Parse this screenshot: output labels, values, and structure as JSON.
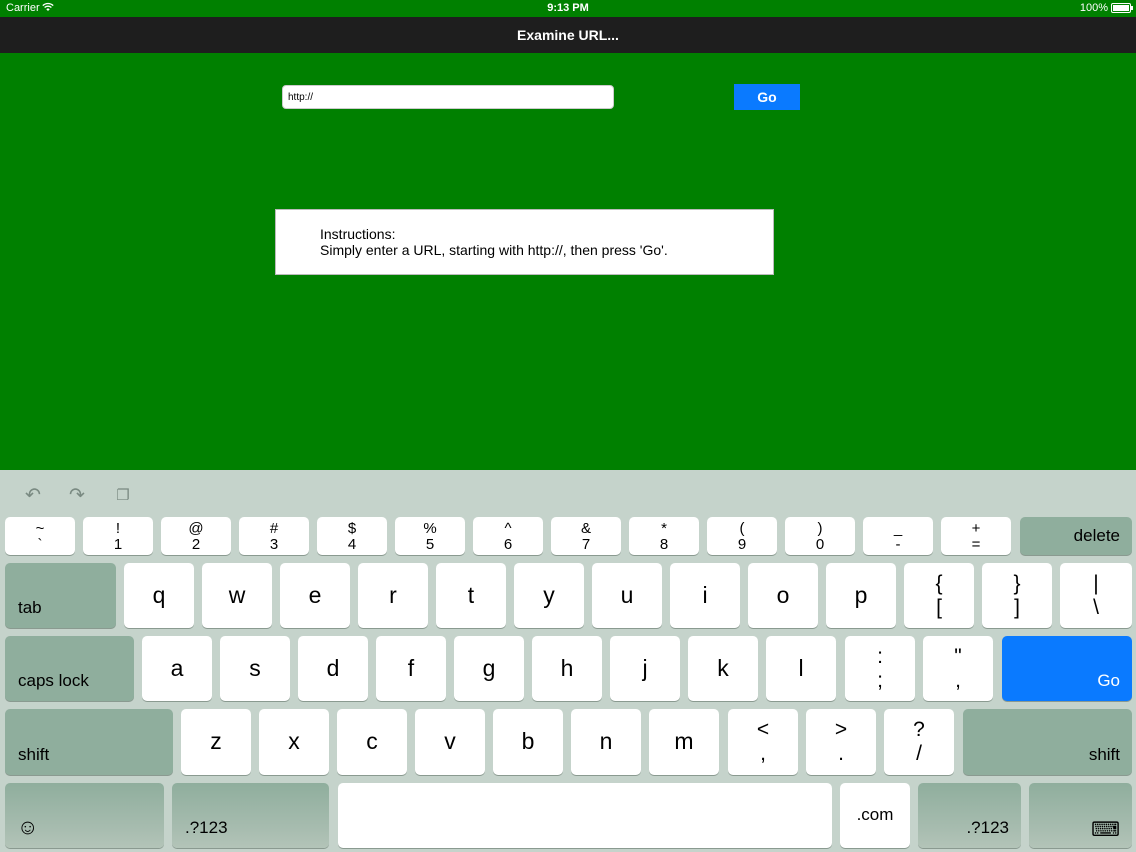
{
  "status_bar": {
    "carrier": "Carrier",
    "time": "9:13 PM",
    "battery": "100%"
  },
  "nav": {
    "title": "Examine URL..."
  },
  "url_field": {
    "value": "http://",
    "placeholder": ""
  },
  "go_button": {
    "label": "Go"
  },
  "instructions": {
    "heading": "Instructions:",
    "text": "Simply enter a URL, starting with http://, then press 'Go'."
  },
  "keyboard": {
    "shortcuts": {
      "undo": "↶",
      "redo": "↷",
      "paste": "❐"
    },
    "number_row": [
      {
        "top": "~",
        "bottom": "`"
      },
      {
        "top": "!",
        "bottom": "1"
      },
      {
        "top": "@",
        "bottom": "2"
      },
      {
        "top": "#",
        "bottom": "3"
      },
      {
        "top": "$",
        "bottom": "4"
      },
      {
        "top": "%",
        "bottom": "5"
      },
      {
        "top": "^",
        "bottom": "6"
      },
      {
        "top": "&",
        "bottom": "7"
      },
      {
        "top": "*",
        "bottom": "8"
      },
      {
        "top": "(",
        "bottom": "9"
      },
      {
        "top": ")",
        "bottom": "0"
      },
      {
        "top": "_",
        "bottom": "-"
      },
      {
        "top": "+",
        "bottom": "="
      }
    ],
    "delete": "delete",
    "tab": "tab",
    "row_q": [
      "q",
      "w",
      "e",
      "r",
      "t",
      "y",
      "u",
      "i",
      "o",
      "p"
    ],
    "row_q_symbols": [
      {
        "top": "{",
        "bottom": "["
      },
      {
        "top": "}",
        "bottom": "]"
      },
      {
        "top": "|",
        "bottom": "\\"
      }
    ],
    "caps_lock": "caps lock",
    "row_a": [
      "a",
      "s",
      "d",
      "f",
      "g",
      "h",
      "j",
      "k",
      "l"
    ],
    "row_a_symbols": [
      {
        "top": ":",
        "bottom": ";"
      },
      {
        "top": "\"",
        "bottom": ","
      }
    ],
    "go": "Go",
    "shift": "shift",
    "row_z": [
      "z",
      "x",
      "c",
      "v",
      "b",
      "n",
      "m"
    ],
    "row_z_symbols": [
      {
        "top": "<",
        "bottom": ","
      },
      {
        "top": ">",
        "bottom": "."
      },
      {
        "top": "?",
        "bottom": "/"
      }
    ],
    "emoji": "☺",
    "num_switch": ".?123",
    "dotcom": ".com",
    "dismiss": "⌨"
  },
  "colors": {
    "background": "#008000",
    "nav_bar": "#1e1e1e",
    "accent_blue": "#0a7aff",
    "keyboard_bg": "#c5d3cb",
    "dark_key": "#8fae9d"
  }
}
